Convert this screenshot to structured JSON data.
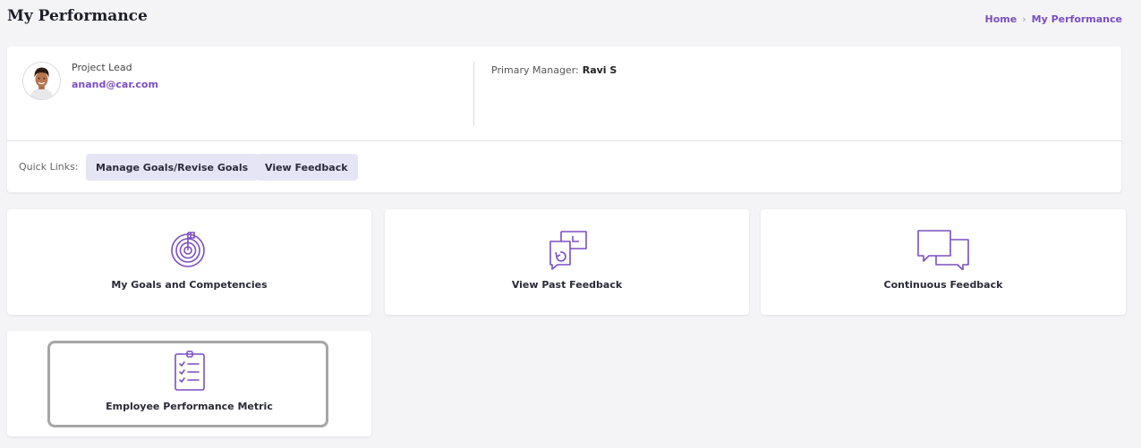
{
  "header": {
    "title": "My Performance",
    "breadcrumb": {
      "home": "Home",
      "separator": "›",
      "current": "My Performance"
    }
  },
  "profile": {
    "role": "Project Lead",
    "email": "anand@car.com",
    "manager_label": "Primary Manager:",
    "manager_name": "Ravi S",
    "avatar_icon": "user-avatar"
  },
  "quick_links": {
    "label": "Quick Links:",
    "items": [
      "Manage Goals/Revise Goals",
      "View Feedback"
    ]
  },
  "tiles": [
    {
      "label": "My Goals and Competencies",
      "icon": "target-icon"
    },
    {
      "label": "View Past Feedback",
      "icon": "feedback-history-icon"
    },
    {
      "label": "Continuous Feedback",
      "icon": "chat-bubbles-icon"
    },
    {
      "label": "Employee Performance Metric",
      "icon": "clipboard-checklist-icon"
    }
  ],
  "colors": {
    "accent": "#7b4fc1",
    "quick_link_bg": "#e6e5f6",
    "page_bg": "#f4f4f6"
  }
}
